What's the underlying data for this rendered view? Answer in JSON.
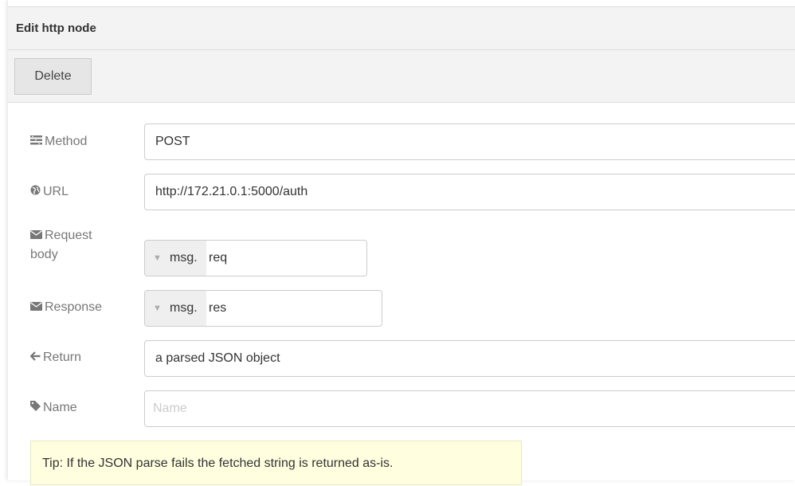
{
  "tray": {
    "title": "Edit http node",
    "delete_label": "Delete"
  },
  "form": {
    "method": {
      "label": "Method",
      "icon": "tasks-icon",
      "value": "POST"
    },
    "url": {
      "label": "URL",
      "icon": "globe-icon",
      "value": "http://172.21.0.1:5000/auth"
    },
    "request_body": {
      "label_line1": "Request",
      "label_line2": "body",
      "icon": "envelope-icon",
      "type_label": "msg.",
      "value": "req"
    },
    "response": {
      "label": "Response",
      "icon": "envelope-icon",
      "type_label": "msg.",
      "value": "res"
    },
    "return": {
      "label": "Return",
      "icon": "arrow-left-icon",
      "value": "a parsed JSON object"
    },
    "name": {
      "label": "Name",
      "icon": "tag-icon",
      "placeholder": "Name",
      "value": ""
    }
  },
  "tip": "Tip: If the JSON parse fails the fetched string is returned as-is.",
  "colors": {
    "label": "#777777",
    "header_bg": "#f3f3f3",
    "tip_bg": "#ffffe0"
  }
}
